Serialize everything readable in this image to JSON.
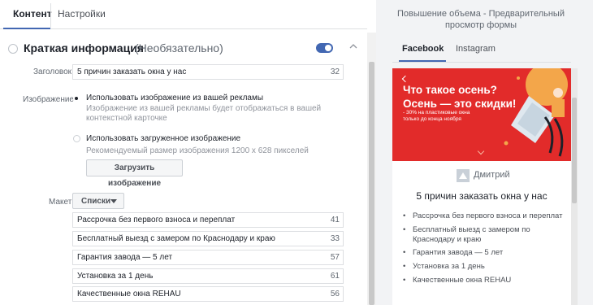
{
  "tabs": {
    "content": "Контент",
    "settings": "Настройки"
  },
  "section": {
    "title": "Краткая информация",
    "optional": "(Необязательно)",
    "toggle_on": true
  },
  "headline": {
    "label": "Заголовок",
    "value": "5 причин заказать окна у нас",
    "count": "32"
  },
  "image": {
    "label": "Изображение",
    "option1_title": "Использовать изображение из вашей рекламы",
    "option1_desc": "Изображение из вашей рекламы будет отображаться в вашей контекстной карточке",
    "option2_title": "Использовать загруженное изображение",
    "option2_desc": "Рекомендуемый размер изображения 1200 x 628 пикселей",
    "upload_button": "Загрузить изображение"
  },
  "layout": {
    "label": "Макет",
    "select_value": "Списки",
    "items": [
      {
        "text": "Рассрочка без первого взноса и переплат",
        "count": "41"
      },
      {
        "text": "Бесплатный выезд с замером по Краснодару и краю",
        "count": "33"
      },
      {
        "text": "Гарантия завода — 5 лет",
        "count": "57"
      },
      {
        "text": "Установка за 1 день",
        "count": "61"
      },
      {
        "text": "Качественные окна REHAU",
        "count": "56"
      }
    ]
  },
  "preview": {
    "title": "Повышение объема - Предварительный просмотр формы",
    "tab_facebook": "Facebook",
    "tab_instagram": "Instagram",
    "banner_line1": "Что такое осень?",
    "banner_line2": "Осень — это скидки!",
    "banner_sub1": "- 30% на пластиковые окна",
    "banner_sub2": "только до конца ноября",
    "profile_name": "Дмитрий",
    "card_title": "5 причин заказать окна у нас",
    "bullets": [
      "Рассрочка без первого взноса и переплат",
      "Бесплатный выезд с замером по Краснодару и краю",
      "Гарантия завода — 5 лет",
      "Установка за 1 день",
      "Качественные окна REHAU"
    ]
  },
  "colors": {
    "accent": "#4267b2",
    "banner": "#e22b2a",
    "panel_bg": "#f2f3f5"
  }
}
